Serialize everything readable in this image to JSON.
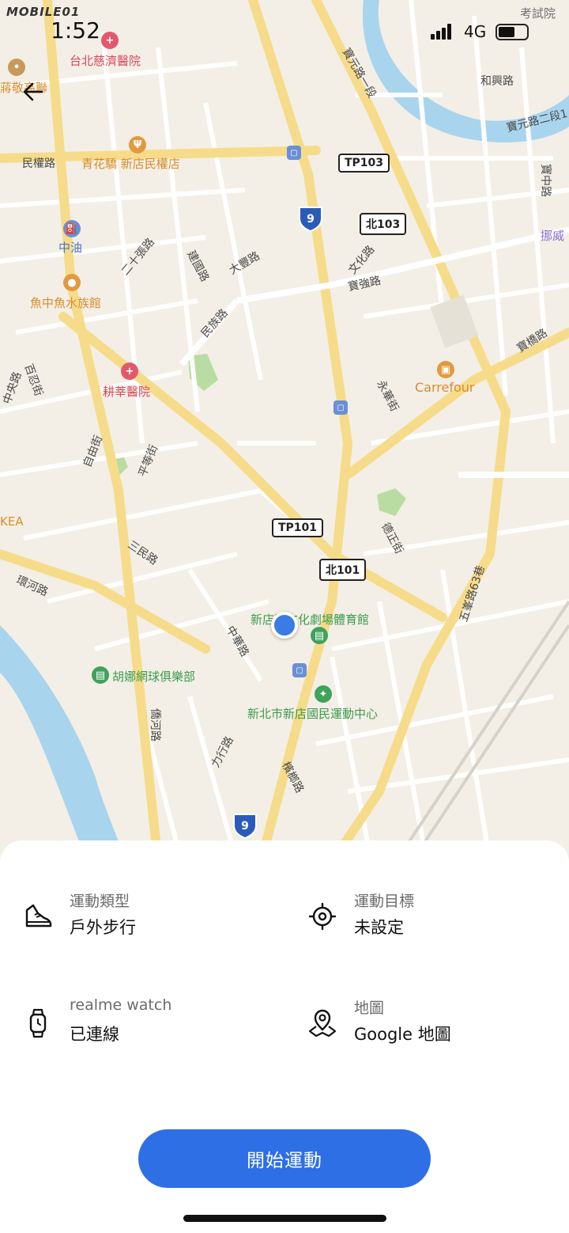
{
  "status_bar": {
    "watermark": "MOBILE01",
    "time": "1:52",
    "network": "4G"
  },
  "map": {
    "pois": {
      "hospital_1": "台北慈濟醫院",
      "restaurant": "青花驕 新店民權店",
      "gas": "中油",
      "aquarium": "魚中魚水族館",
      "hospital_2": "耕莘醫院",
      "carrefour": "Carrefour",
      "venue": "新店區文化劇場體育館",
      "tennis": "胡娜網球俱樂部",
      "sports_center": "新北市新店國民運動中心",
      "exam": "考試院",
      "ikea": "KEA",
      "memorial": "蔣敬高聯",
      "nuowei": "挪威"
    },
    "streets": {
      "minquan": "民權路",
      "baoyuan1": "寶元路一段",
      "baoyuan2": "寶元路二段1",
      "hexing": "和興路",
      "baozhong": "寶中路",
      "ershizhang": "二十張路",
      "jianguo": "建國路",
      "dafeng": "大豐路",
      "wenhua": "文化路",
      "baoqiang": "寶強路",
      "minzu": "民族路",
      "baoqiao": "寶橋路",
      "baizhong": "百忍街",
      "ziyou": "自由街",
      "pingdeng": "平等街",
      "yonghua": "永華街",
      "sanmin": "三民路",
      "zhonghua": "中華路",
      "huanhe": "環河路",
      "dezheng": "德正街",
      "wufeng": "五峯路63巷",
      "lixing": "力行路",
      "qiaohe": "僑河路",
      "longan": "檳榔路",
      "zhongyang": "中央路"
    },
    "shields": {
      "tp103": "TP103",
      "bei103": "北103",
      "tp101": "TP101",
      "bei101": "北101",
      "route9": "9"
    }
  },
  "sheet": {
    "sport_type": {
      "label": "運動類型",
      "value": "戶外步行",
      "icon": "shoe-icon"
    },
    "goal": {
      "label": "運動目標",
      "value": "未設定",
      "icon": "target-icon"
    },
    "watch": {
      "label": "realme watch",
      "value": "已連線",
      "icon": "watch-icon"
    },
    "map_provider": {
      "label": "地圖",
      "value": "Google 地圖",
      "icon": "map-pin-icon"
    },
    "start_label": "開始運動"
  },
  "colors": {
    "accent": "#2e6fe6",
    "location_dot": "#3a7be4",
    "map_bg": "#f3efe6",
    "road_major": "#f6dc8a",
    "water": "#a9d4ee"
  }
}
